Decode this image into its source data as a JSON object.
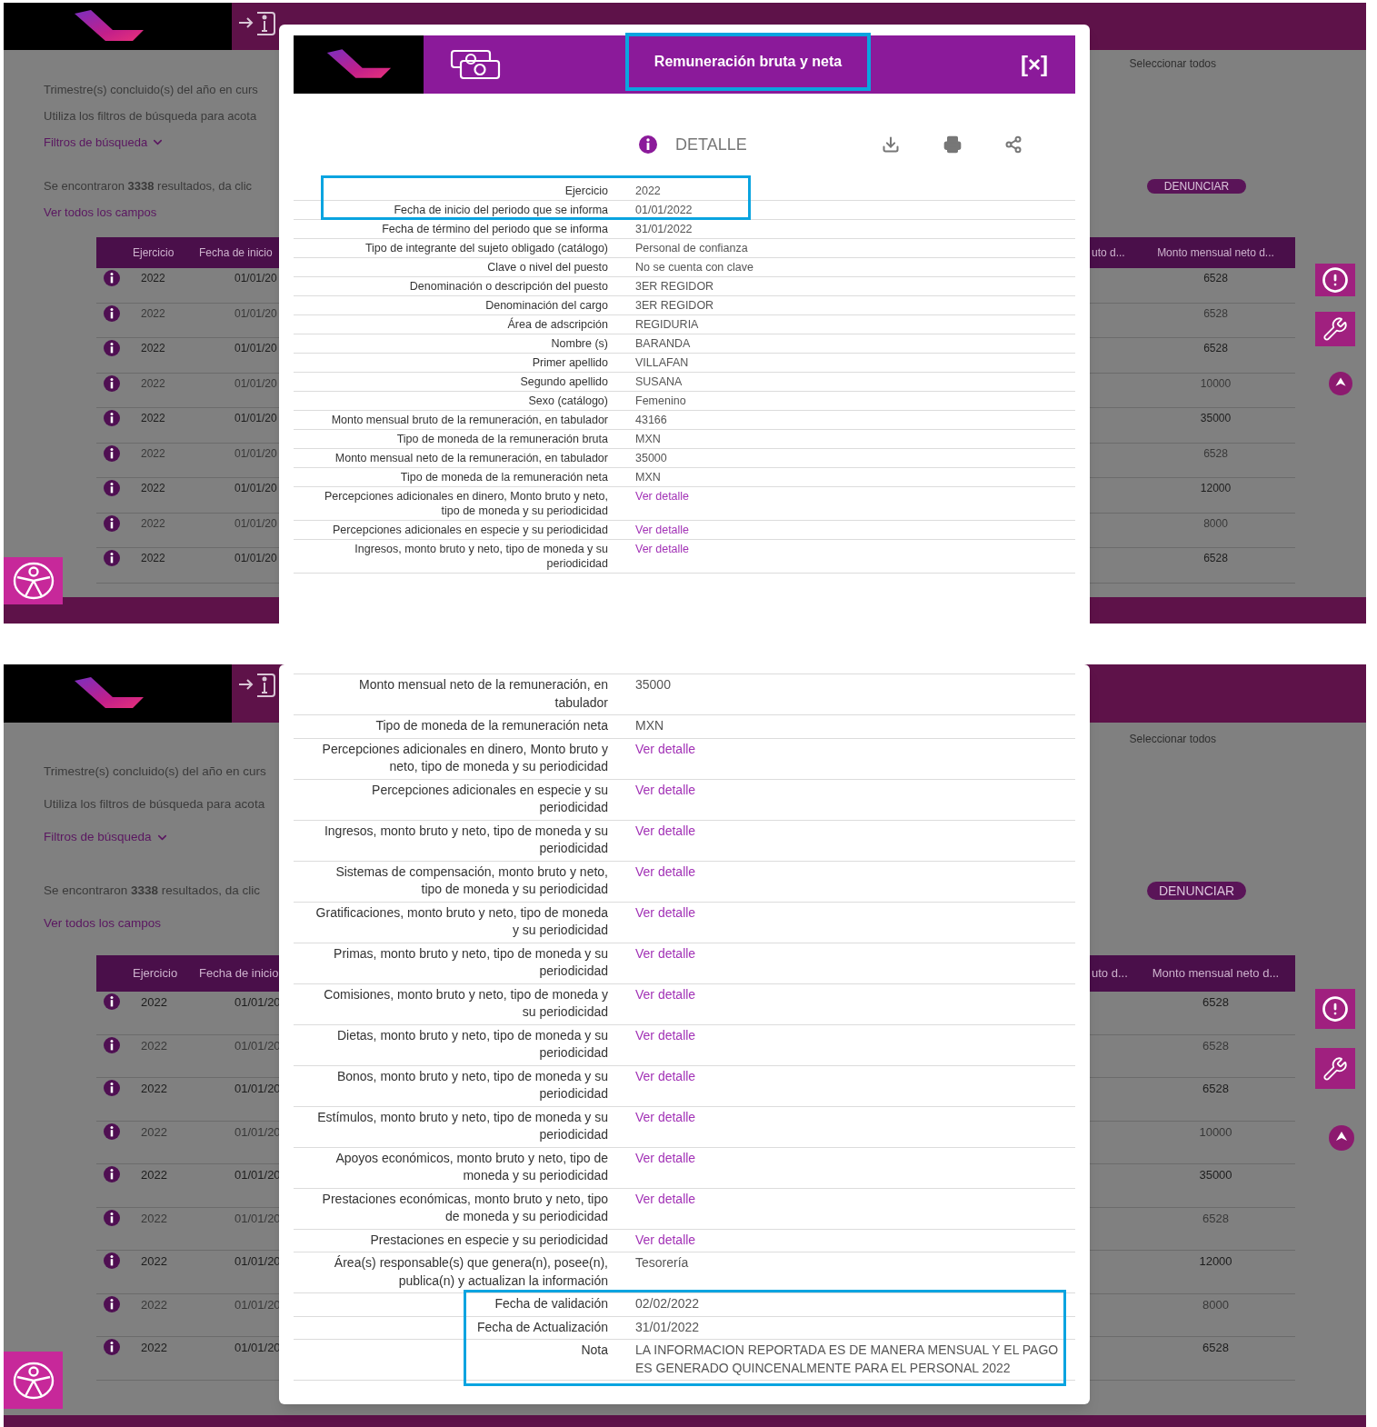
{
  "panels": [
    {
      "page": {
        "select_all": "Seleccionar todos",
        "texts": [
          {
            "kind": "plain",
            "text": "Trimestre(s) concluido(s) del año en curs"
          },
          {
            "kind": "plain",
            "text": "Utiliza los filtros de búsqueda para acota"
          },
          {
            "kind": "dropdown",
            "text": "Filtros de búsqueda"
          },
          {
            "kind": "rich",
            "text": "Se encontraron **3338** resultados, da clic"
          },
          {
            "kind": "link",
            "text": "Ver todos los campos"
          }
        ],
        "report_button": "DENUNCIAR",
        "table": {
          "columns": [
            "Ejercicio",
            "Fecha de inicio",
            "uto d...",
            "Monto mensual neto d..."
          ],
          "rows": [
            {
              "ejercicio": "2022",
              "fecha": "01/01/20",
              "monto_neto": "6528"
            },
            {
              "ejercicio": "2022",
              "fecha": "01/01/20",
              "monto_neto": "6528"
            },
            {
              "ejercicio": "2022",
              "fecha": "01/01/20",
              "monto_neto": "6528"
            },
            {
              "ejercicio": "2022",
              "fecha": "01/01/20",
              "monto_neto": "10000"
            },
            {
              "ejercicio": "2022",
              "fecha": "01/01/20",
              "monto_neto": "35000"
            },
            {
              "ejercicio": "2022",
              "fecha": "01/01/20",
              "monto_neto": "6528"
            },
            {
              "ejercicio": "2022",
              "fecha": "01/01/20",
              "monto_neto": "12000"
            },
            {
              "ejercicio": "2022",
              "fecha": "01/01/20",
              "monto_neto": "8000"
            },
            {
              "ejercicio": "2022",
              "fecha": "01/01/20",
              "monto_neto": "6528"
            }
          ]
        }
      },
      "modal": {
        "title": "Remuneración bruta y neta",
        "title_highlighted": true,
        "close": "[×]",
        "section": "DETALLE",
        "rows": [
          {
            "label": "Ejercicio",
            "value": "2022",
            "kind": "text",
            "highlighted": true
          },
          {
            "label": "Fecha de inicio del periodo que se informa",
            "value": "01/01/2022",
            "kind": "text",
            "highlighted": true
          },
          {
            "label": "Fecha de término del periodo que se informa",
            "value": "31/01/2022",
            "kind": "text",
            "highlighted": false
          },
          {
            "label": "Tipo de integrante del sujeto obligado (catálogo)",
            "value": "Personal de confianza",
            "kind": "text",
            "highlighted": false
          },
          {
            "label": "Clave o nivel del puesto",
            "value": "No se cuenta con clave",
            "kind": "text",
            "highlighted": false
          },
          {
            "label": "Denominación o descripción del puesto",
            "value": "3ER REGIDOR",
            "kind": "text",
            "highlighted": false
          },
          {
            "label": "Denominación del cargo",
            "value": "3ER REGIDOR",
            "kind": "text",
            "highlighted": false
          },
          {
            "label": "Área de adscripción",
            "value": "REGIDURIA",
            "kind": "text",
            "highlighted": false
          },
          {
            "label": "Nombre (s)",
            "value": "BARANDA",
            "kind": "text",
            "highlighted": false
          },
          {
            "label": "Primer apellido",
            "value": "VILLAFAN",
            "kind": "text",
            "highlighted": false
          },
          {
            "label": "Segundo apellido",
            "value": "SUSANA",
            "kind": "text",
            "highlighted": false
          },
          {
            "label": "Sexo (catálogo)",
            "value": "Femenino",
            "kind": "text",
            "highlighted": false
          },
          {
            "label": "Monto mensual bruto de la remuneración, en tabulador",
            "value": "43166",
            "kind": "text",
            "highlighted": false
          },
          {
            "label": "Tipo de moneda de la remuneración bruta",
            "value": "MXN",
            "kind": "text",
            "highlighted": false
          },
          {
            "label": "Monto mensual neto de la remuneración, en tabulador",
            "value": "35000",
            "kind": "text",
            "highlighted": false
          },
          {
            "label": "Tipo de moneda de la remuneración neta",
            "value": "MXN",
            "kind": "text",
            "highlighted": false
          },
          {
            "label": "Percepciones adicionales en dinero, Monto bruto y neto, tipo de moneda y su periodicidad",
            "value": "Ver detalle",
            "kind": "link",
            "highlighted": false
          },
          {
            "label": "Percepciones adicionales en especie y su periodicidad",
            "value": "Ver detalle",
            "kind": "link",
            "highlighted": false
          },
          {
            "label": "Ingresos, monto bruto y neto, tipo de moneda y su periodicidad",
            "value": "Ver detalle",
            "kind": "link",
            "highlighted": false
          }
        ]
      }
    },
    {
      "page": {
        "select_all": "Seleccionar todos",
        "texts": [
          {
            "kind": "plain",
            "text": "Trimestre(s) concluido(s) del año en curs"
          },
          {
            "kind": "plain",
            "text": "Utiliza los filtros de búsqueda para acota"
          },
          {
            "kind": "dropdown",
            "text": "Filtros de búsqueda"
          },
          {
            "kind": "rich",
            "text": "Se encontraron **3338** resultados, da clic"
          },
          {
            "kind": "link",
            "text": "Ver todos los campos"
          }
        ],
        "report_button": "DENUNCIAR",
        "table": {
          "columns": [
            "Ejercicio",
            "Fecha de inicio",
            "uto d...",
            "Monto mensual neto d..."
          ],
          "rows": [
            {
              "ejercicio": "2022",
              "fecha": "01/01/20",
              "monto_neto": "6528"
            },
            {
              "ejercicio": "2022",
              "fecha": "01/01/20",
              "monto_neto": "6528"
            },
            {
              "ejercicio": "2022",
              "fecha": "01/01/20",
              "monto_neto": "6528"
            },
            {
              "ejercicio": "2022",
              "fecha": "01/01/20",
              "monto_neto": "10000"
            },
            {
              "ejercicio": "2022",
              "fecha": "01/01/20",
              "monto_neto": "35000"
            },
            {
              "ejercicio": "2022",
              "fecha": "01/01/20",
              "monto_neto": "6528"
            },
            {
              "ejercicio": "2022",
              "fecha": "01/01/20",
              "monto_neto": "12000"
            },
            {
              "ejercicio": "2022",
              "fecha": "01/01/20",
              "monto_neto": "8000"
            },
            {
              "ejercicio": "2022",
              "fecha": "01/01/20",
              "monto_neto": "6528"
            }
          ]
        }
      },
      "modal": {
        "rows": [
          {
            "label": "Monto mensual neto de la remuneración, en tabulador",
            "value": "35000",
            "kind": "text",
            "highlighted": false
          },
          {
            "label": "Tipo de moneda de la remuneración neta",
            "value": "MXN",
            "kind": "text",
            "highlighted": false
          },
          {
            "label": "Percepciones adicionales en dinero, Monto bruto y neto, tipo de moneda y su periodicidad",
            "value": "Ver detalle",
            "kind": "link",
            "highlighted": false
          },
          {
            "label": "Percepciones adicionales en especie y su periodicidad",
            "value": "Ver detalle",
            "kind": "link",
            "highlighted": false
          },
          {
            "label": "Ingresos, monto bruto y neto, tipo de moneda y su periodicidad",
            "value": "Ver detalle",
            "kind": "link",
            "highlighted": false
          },
          {
            "label": "Sistemas de compensación, monto bruto y neto, tipo de moneda y su periodicidad",
            "value": "Ver detalle",
            "kind": "link",
            "highlighted": false
          },
          {
            "label": "Gratificaciones, monto bruto y neto, tipo de moneda y su periodicidad",
            "value": "Ver detalle",
            "kind": "link",
            "highlighted": false
          },
          {
            "label": "Primas, monto bruto y neto, tipo de moneda y su periodicidad",
            "value": "Ver detalle",
            "kind": "link",
            "highlighted": false
          },
          {
            "label": "Comisiones, monto bruto y neto, tipo de moneda y su periodicidad",
            "value": "Ver detalle",
            "kind": "link",
            "highlighted": false
          },
          {
            "label": "Dietas, monto bruto y neto, tipo de moneda y su periodicidad",
            "value": "Ver detalle",
            "kind": "link",
            "highlighted": false
          },
          {
            "label": "Bonos, monto bruto y neto, tipo de moneda y su periodicidad",
            "value": "Ver detalle",
            "kind": "link",
            "highlighted": false
          },
          {
            "label": "Estímulos, monto bruto y neto, tipo de moneda y su periodicidad",
            "value": "Ver detalle",
            "kind": "link",
            "highlighted": false
          },
          {
            "label": "Apoyos económicos, monto bruto y neto, tipo de moneda y su periodicidad",
            "value": "Ver detalle",
            "kind": "link",
            "highlighted": false
          },
          {
            "label": "Prestaciones económicas, monto bruto y neto, tipo de moneda y su periodicidad",
            "value": "Ver detalle",
            "kind": "link",
            "highlighted": false
          },
          {
            "label": "Prestaciones en especie y su periodicidad",
            "value": "Ver detalle",
            "kind": "link",
            "highlighted": false
          },
          {
            "label": "Área(s) responsable(s) que genera(n), posee(n), publica(n) y actualizan la información",
            "value": "Tesorería",
            "kind": "text",
            "highlighted": false
          },
          {
            "label": "Fecha de validación",
            "value": "02/02/2022",
            "kind": "text",
            "highlighted": true
          },
          {
            "label": "Fecha de Actualización",
            "value": "31/01/2022",
            "kind": "text",
            "highlighted": true
          },
          {
            "label": "Nota",
            "value": "LA INFORMACION REPORTADA ES DE MANERA MENSUAL Y EL PAGO ES GENERADO QUINCENALMENTE PARA EL PERSONAL 2022",
            "kind": "text",
            "highlighted": true
          }
        ]
      }
    }
  ]
}
